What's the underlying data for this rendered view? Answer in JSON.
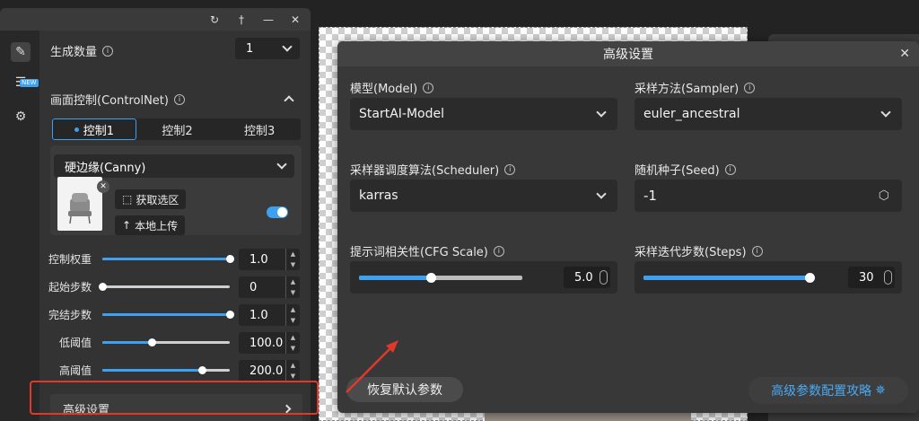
{
  "left_panel": {
    "generate_count": {
      "label": "生成数量",
      "value": "1"
    },
    "controlnet": {
      "label": "画面控制(ControlNet)",
      "tabs": [
        "控制1",
        "控制2",
        "控制3"
      ],
      "preprocessor": "硬边缘(Canny)",
      "get_selection": "获取选区",
      "local_upload": "本地上传",
      "sliders": [
        {
          "label": "控制权重",
          "value": "1.0",
          "fraction": 1.0
        },
        {
          "label": "起始步数",
          "value": "0",
          "fraction": 0.0
        },
        {
          "label": "完结步数",
          "value": "1.0",
          "fraction": 1.0
        },
        {
          "label": "低阈值",
          "value": "100.0",
          "fraction": 0.39
        },
        {
          "label": "高阈值",
          "value": "200.0",
          "fraction": 0.78
        }
      ]
    },
    "advanced_settings": "高级设置",
    "new_badge": "NEW"
  },
  "modal": {
    "title": "高级设置",
    "model": {
      "label": "模型(Model)",
      "value": "StartAI-Model"
    },
    "sampler": {
      "label": "采样方法(Sampler)",
      "value": "euler_ancestral"
    },
    "scheduler": {
      "label": "采样器调度算法(Scheduler)",
      "value": "karras"
    },
    "seed": {
      "label": "随机种子(Seed)",
      "value": "-1"
    },
    "cfg": {
      "label": "提示词相关性(CFG Scale)",
      "value": "5.0",
      "fraction": 0.44
    },
    "steps": {
      "label": "采样迭代步数(Steps)",
      "value": "30",
      "fraction": 1.0
    },
    "reset": "恢复默认参数",
    "guide": "高级参数配置攻略",
    "guide_icon": "sparkle-icon"
  },
  "colors": {
    "accent": "#3da0f0",
    "highlight": "#e0392b"
  }
}
